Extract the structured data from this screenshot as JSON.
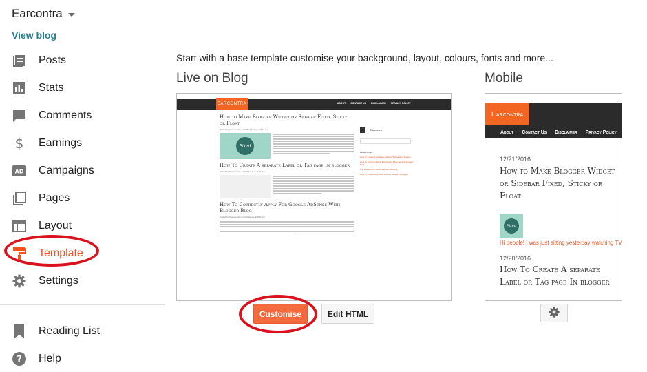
{
  "sidebar": {
    "blog_title": "Earcontra",
    "view_blog": "View blog",
    "items": [
      {
        "label": "Posts",
        "icon": "posts-icon"
      },
      {
        "label": "Stats",
        "icon": "stats-icon"
      },
      {
        "label": "Comments",
        "icon": "comments-icon"
      },
      {
        "label": "Earnings",
        "icon": "dollar-icon"
      },
      {
        "label": "Campaigns",
        "icon": "ad-icon"
      },
      {
        "label": "Pages",
        "icon": "pages-icon"
      },
      {
        "label": "Layout",
        "icon": "layout-icon"
      },
      {
        "label": "Template",
        "icon": "paint-roller-icon",
        "active": true
      },
      {
        "label": "Settings",
        "icon": "gear-icon"
      }
    ],
    "secondary": [
      {
        "label": "Reading List",
        "icon": "bookmark-icon"
      },
      {
        "label": "Help",
        "icon": "help-icon"
      }
    ]
  },
  "main": {
    "intro": "Start with a base template customise your background, layout, colours, fonts and more...",
    "live_title": "Live on Blog",
    "mobile_title": "Mobile",
    "customise_button": "Customise",
    "edit_html_button": "Edit HTML"
  },
  "desktop_preview": {
    "logo": "EARCONTRA",
    "menu": [
      "ABOUT",
      "CONTACT US",
      "DISCLAIMER",
      "PRIVACY POLICY"
    ],
    "posts": [
      {
        "title": "How to Make Blogger Widget or Sidebar Fixed, Sticky or Float",
        "meta": "Posted by Osanga Dev on In Blog Design at 8:17 am",
        "thumb_text": "Fixed"
      },
      {
        "title": "How To Create A separate Label or Tag page In blogger",
        "meta": "Posted by Osanga Dev on In Tutorial at 11:31 am"
      },
      {
        "title": "How To Correctly Apply For Google AdSense With Blogger Blog",
        "meta": "Posted by Osanga Dev on In Adsense at 9:32 pm"
      }
    ],
    "sidebar_name": "Earcontra",
    "sidebar_head": "Recent Posts",
    "sidebar_links": [
      "How To Create A separate Label or Tag page In blogger",
      "How To Correctly Apply For Google AdSense With Blogger Blog",
      "Top 5 website to Check Website Ranking",
      "How To Create Auto Date Counter Widget In Blogger"
    ]
  },
  "mobile_preview": {
    "logo": "Earcontra",
    "menu": [
      "About",
      "Contact Us",
      "Disclaimer",
      "Privacy Policy"
    ],
    "posts": [
      {
        "date": "12/21/2016",
        "title": "How to Make Blogger Widget or Sidebar Fixed, Sticky or Float"
      },
      {
        "date": "12/20/2016",
        "title": "How To Create A separate Label or Tag page In blogger"
      }
    ],
    "excerpt": "Hi people! I was just sitting yesterday watching TV  when this thought occurred to me, and I tho...",
    "thumb_text": "Fixed"
  },
  "colors": {
    "accent": "#f4511e",
    "link": "#2a7d8a",
    "highlight_ring": "#d8131d",
    "button_primary": "#f4693d"
  }
}
